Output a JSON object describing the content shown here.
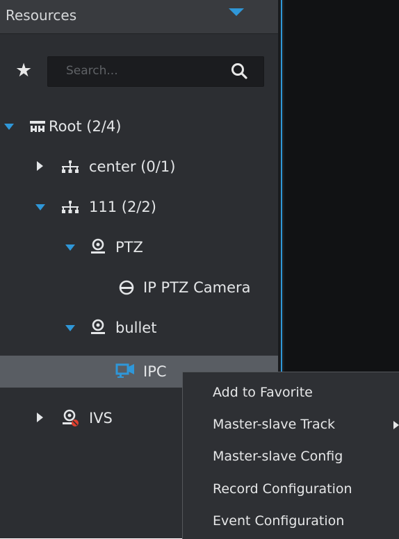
{
  "panel": {
    "title": "Resources"
  },
  "search": {
    "placeholder": "Search..."
  },
  "tree": {
    "root": "Root (2/4)",
    "center": "center (0/1)",
    "group111": "111 (2/2)",
    "ptz": "PTZ",
    "ip_ptz_camera": "IP PTZ Camera",
    "bullet": "bullet",
    "ipc": "IPC",
    "ivs": "IVS"
  },
  "context_menu": {
    "items": [
      "Add to Favorite",
      "Master-slave Track",
      "Master-slave Config",
      "Record Configuration",
      "Event Configuration"
    ]
  },
  "colors": {
    "accent": "#2f97d8",
    "panel_bg": "#2c2e32",
    "selected_row": "#595d63",
    "alarm_red": "#e0412f"
  }
}
